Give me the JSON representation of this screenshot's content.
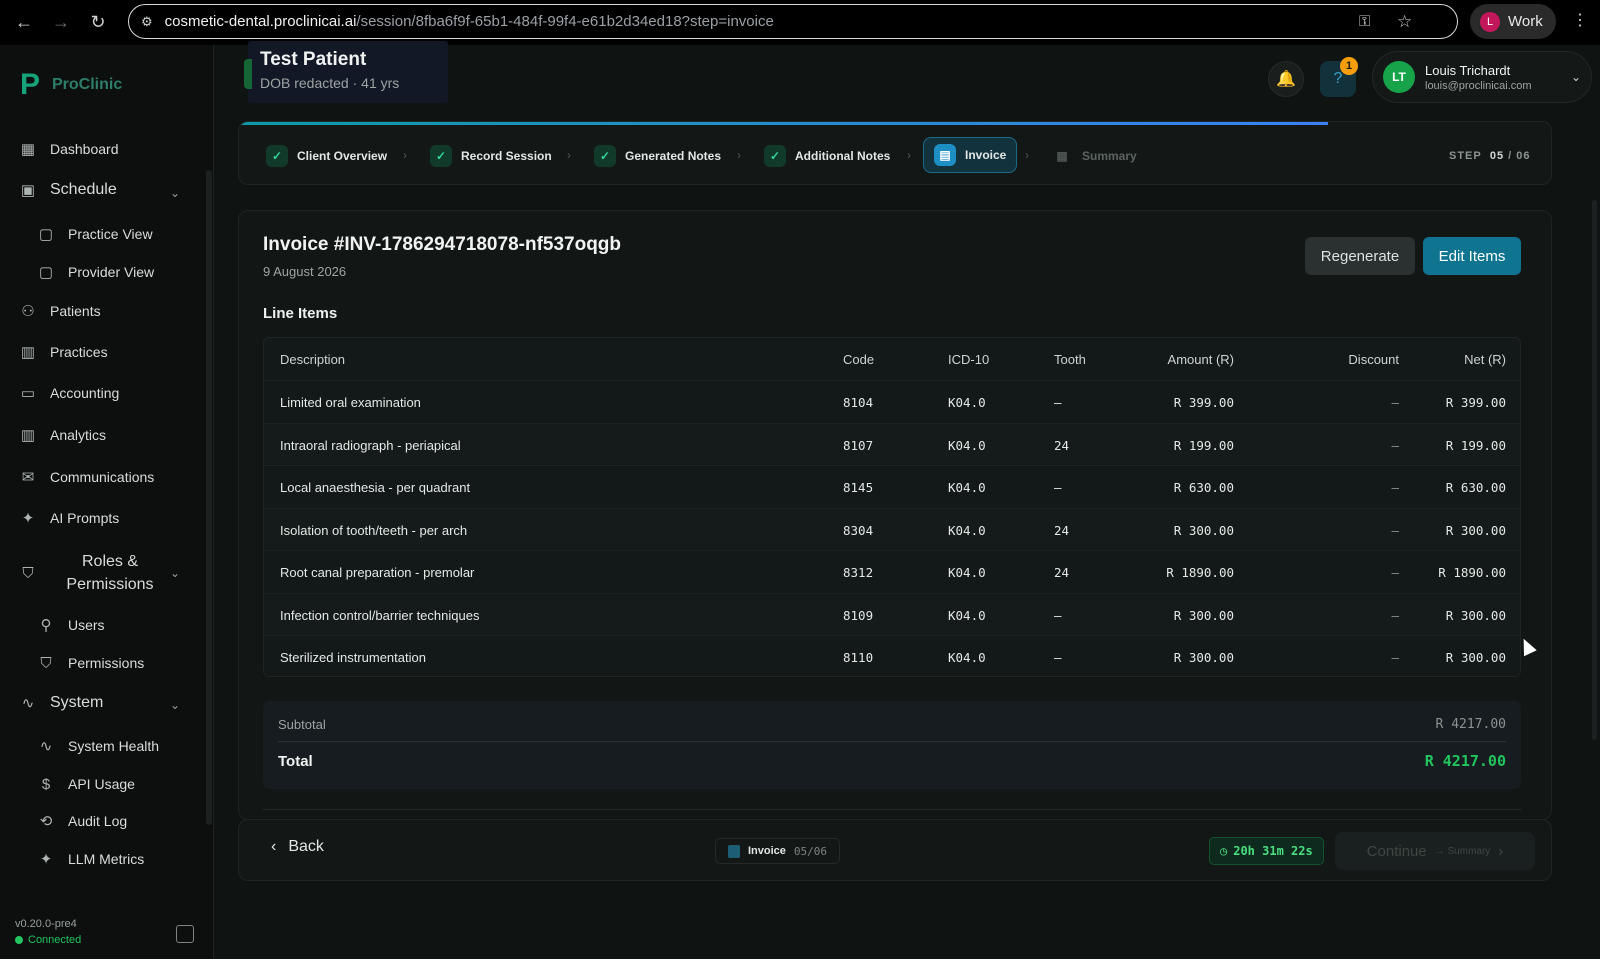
{
  "browser": {
    "url_host": "cosmetic-dental.proclinicai.ai",
    "url_path": "/session/8fba6f9f-65b1-484f-99f4-e61b2d34ed18?step=invoice",
    "profile_initial": "L",
    "profile_label": "Work"
  },
  "brand": {
    "name": "ProClinic"
  },
  "sidebar": {
    "items": [
      {
        "label": "Dashboard",
        "icon": "dashboard-icon"
      },
      {
        "label": "Schedule",
        "icon": "calendar-icon"
      },
      {
        "label": "Practice View",
        "icon": "calendar-icon"
      },
      {
        "label": "Provider View",
        "icon": "calendar-icon"
      },
      {
        "label": "Patients",
        "icon": "users-icon"
      },
      {
        "label": "Practices",
        "icon": "building-icon"
      },
      {
        "label": "Accounting",
        "icon": "card-icon"
      },
      {
        "label": "Analytics",
        "icon": "chart-icon"
      },
      {
        "label": "Communications",
        "icon": "mail-icon"
      },
      {
        "label": "AI Prompts",
        "icon": "sparkle-icon"
      },
      {
        "label": "Roles &",
        "label2": "Permissions",
        "icon": "shield-icon"
      },
      {
        "label": "Users",
        "icon": "user-icon"
      },
      {
        "label": "Permissions",
        "icon": "shield-icon"
      },
      {
        "label": "System",
        "icon": "pulse-icon"
      },
      {
        "label": "System Health",
        "icon": "pulse-icon"
      },
      {
        "label": "API Usage",
        "icon": "dollar-icon"
      },
      {
        "label": "Audit Log",
        "icon": "history-icon"
      },
      {
        "label": "LLM Metrics",
        "icon": "sparkle-icon"
      }
    ],
    "version": "v0.20.0-pre4",
    "status": "Connected"
  },
  "patient": {
    "name": "Test Patient",
    "dob": "DOB redacted",
    "age": "41 yrs"
  },
  "header": {
    "help_badge": "1",
    "user_initials": "LT",
    "user_name": "Louis Trichardt",
    "user_email": "louis@proclinicai.com"
  },
  "stepper": {
    "progress": 0.83,
    "steps": [
      {
        "label": "Client Overview",
        "state": "done"
      },
      {
        "label": "Record Session",
        "state": "done"
      },
      {
        "label": "Generated Notes",
        "state": "done"
      },
      {
        "label": "Additional Notes",
        "state": "done"
      },
      {
        "label": "Invoice",
        "state": "active"
      },
      {
        "label": "Summary",
        "state": "future"
      }
    ],
    "step_prefix": "STEP",
    "step_current": "05",
    "step_total": "/ 06"
  },
  "invoice": {
    "title": "Invoice #INV-1786294718078-nf537oqgb",
    "date": "9 August 2026",
    "regenerate_label": "Regenerate",
    "edit_label": "Edit Items",
    "section_title": "Line Items",
    "columns": [
      "Description",
      "Code",
      "ICD-10",
      "Tooth",
      "Amount (R)",
      "Discount",
      "Net (R)"
    ],
    "rows": [
      {
        "desc": "Limited oral examination",
        "code": "8104",
        "icd": "K04.0",
        "tooth": "—",
        "amount": "R 399.00",
        "discount": "–",
        "net": "R 399.00"
      },
      {
        "desc": "Intraoral radiograph - periapical",
        "code": "8107",
        "icd": "K04.0",
        "tooth": "24",
        "amount": "R 199.00",
        "discount": "–",
        "net": "R 199.00"
      },
      {
        "desc": "Local anaesthesia - per quadrant",
        "code": "8145",
        "icd": "K04.0",
        "tooth": "—",
        "amount": "R 630.00",
        "discount": "–",
        "net": "R 630.00"
      },
      {
        "desc": "Isolation of tooth/teeth - per arch",
        "code": "8304",
        "icd": "K04.0",
        "tooth": "24",
        "amount": "R 300.00",
        "discount": "–",
        "net": "R 300.00"
      },
      {
        "desc": "Root canal preparation - premolar",
        "code": "8312",
        "icd": "K04.0",
        "tooth": "24",
        "amount": "R 1890.00",
        "discount": "–",
        "net": "R 1890.00"
      },
      {
        "desc": "Infection control/barrier techniques",
        "code": "8109",
        "icd": "K04.0",
        "tooth": "—",
        "amount": "R 300.00",
        "discount": "–",
        "net": "R 300.00"
      },
      {
        "desc": "Sterilized instrumentation",
        "code": "8110",
        "icd": "K04.0",
        "tooth": "—",
        "amount": "R 300.00",
        "discount": "–",
        "net": "R 300.00"
      }
    ],
    "subtotal_label": "Subtotal",
    "subtotal_value": "R 4217.00",
    "total_label": "Total",
    "total_value": "R 4217.00"
  },
  "footer": {
    "back_label": "Back",
    "step_label": "Invoice",
    "step_count": "05/06",
    "timer": "20h 31m 22s",
    "continue_label": "Continue",
    "continue_next": "→ Summary"
  }
}
